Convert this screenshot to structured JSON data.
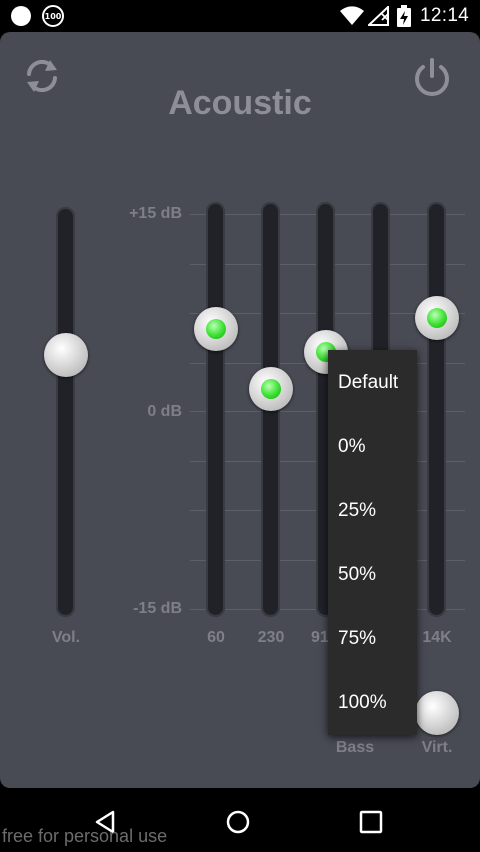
{
  "status_bar": {
    "notification_badge": "100",
    "time": "12:14"
  },
  "app": {
    "preset_title": "Acoustic",
    "refresh_icon": "refresh-icon",
    "power_icon": "power-icon",
    "accent_color": "#39e02f"
  },
  "db_scale": {
    "top": "+15 dB",
    "mid": "0 dB",
    "bottom": "-15 dB"
  },
  "sliders": {
    "volume": {
      "label": "Vol."
    },
    "bands": [
      {
        "label": "60"
      },
      {
        "label": "230"
      },
      {
        "label": "91"
      },
      {
        "label": ""
      },
      {
        "label": "14K"
      }
    ],
    "bass": {
      "label": "Bass"
    },
    "virtualizer": {
      "label": "Virt."
    }
  },
  "dropdown_menu": {
    "items": [
      "Default",
      "0%",
      "25%",
      "50%",
      "75%",
      "100%"
    ]
  },
  "nav": {
    "back_icon": "back-icon",
    "home_icon": "home-icon",
    "recents_icon": "recents-icon"
  },
  "watermark": "free for personal use"
}
